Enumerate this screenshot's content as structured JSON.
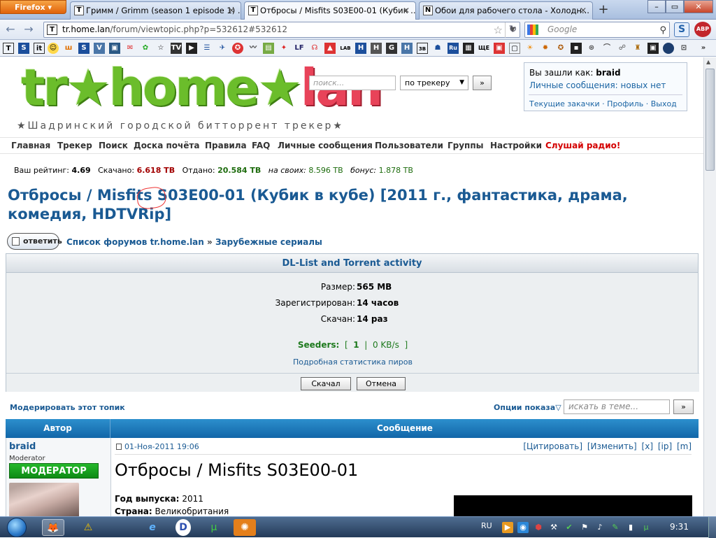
{
  "browser": {
    "menu_button": "Firefox",
    "tabs": [
      {
        "title": "Гримм / Grimm (season 1 episode 1) ...",
        "favicon": "tr-favicon-icon"
      },
      {
        "title": "Отбросы / Misfits S03E00-01 (Кубик ...",
        "favicon": "tr-favicon-icon",
        "active": true
      },
      {
        "title": "Обои для рабочего стола - Холодн...",
        "favicon": "n-favicon-icon"
      }
    ],
    "new_tab": "+",
    "url_host": "tr.home.lan",
    "url_path": "/forum/viewtopic.php?p=532612#532612",
    "search_placeholder": "Google",
    "addon_s": "S",
    "addon_abp": "ABP"
  },
  "site": {
    "logo_main": "tr★home★",
    "logo_lan": "lan",
    "tagline": "★Шадринский городской битторрент трекер★",
    "search_placeholder": "поиск...",
    "search_scope": "по трекеру",
    "search_go": "»"
  },
  "userbox": {
    "logged_as_label": "Вы зашли как:",
    "username": "braid",
    "pm_status": "Личные сообщения: новых нет",
    "links": "Текущие закачки · Профиль · Выход"
  },
  "menu": [
    "Главная",
    "Трекер",
    "Поиск",
    "Доска почёта",
    "Правила",
    "FAQ",
    "Личные сообщения",
    "Пользователи",
    "Группы",
    "Настройки",
    "Слушай радио!"
  ],
  "stats": {
    "rating_label": "Ваш рейтинг:",
    "rating": "4.69",
    "downloaded_label": "Скачано:",
    "downloaded": "6.618 TB",
    "uploaded_label": "Отдано:",
    "uploaded": "20.584 TB",
    "own_label": "на своих:",
    "own": "8.596 TB",
    "bonus_label": "бонус:",
    "bonus": "1.878 TB"
  },
  "topic": {
    "title": "Отбросы / Misfits S03E00-01 (Кубик в кубе) [2011 г., фантастика, драма, комедия, HDTVRip]",
    "reply_button": "ответить",
    "crumb_root": "Список форумов tr.home.lan",
    "crumb_sep": "»",
    "crumb_forum": "Зарубежные сериалы"
  },
  "dl": {
    "header": "DL-List and Torrent activity",
    "size_label": "Размер:",
    "size": "565 MB",
    "registered_label": "Зарегистрирован:",
    "registered": "14 часов",
    "downloaded_label": "Скачан:",
    "downloaded": "14 раз",
    "seeders_label": "Seeders:",
    "seeders_open": "[",
    "seeders_count": "1",
    "seeders_sep": "|",
    "seeders_speed": "0 KB/s",
    "seeders_close": "]",
    "peer_stats_link": "Подробная статистика пиров",
    "download_button": "Скачал",
    "cancel_button": "Отмена"
  },
  "toolbar": {
    "moderate": "Модерировать этот топик",
    "view_options": "Опции показа",
    "topic_search_placeholder": "искать в теме...",
    "topic_search_go": "»"
  },
  "post": {
    "col_author": "Автор",
    "col_message": "Сообщение",
    "author": "braid",
    "author_role": "Moderator",
    "author_badge": "МОДЕРАТОР",
    "date": "01-Ноя-2011 19:06",
    "actions": "[Цитировать] [Изменить] [x] [ip] [m]",
    "title": "Отбросы / Misfits S03E00-01",
    "year_label": "Год выпуска:",
    "year": "2011",
    "country_label": "Страна:",
    "country": "Великобритания"
  },
  "taskbar": {
    "lang": "RU",
    "clock": "9:31"
  }
}
